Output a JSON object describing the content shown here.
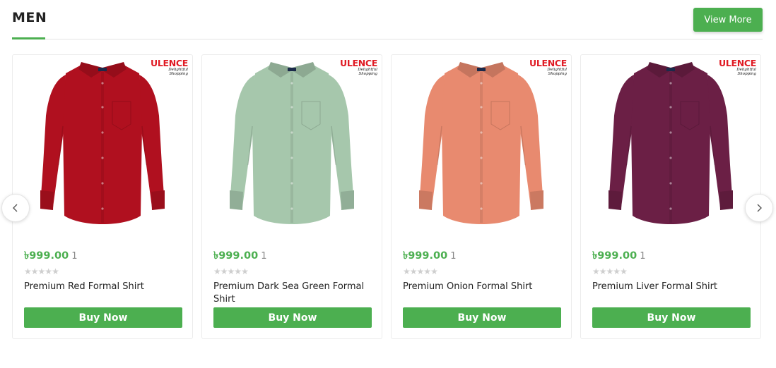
{
  "section": {
    "title": "MEN",
    "view_more_label": "View More",
    "accent_color": "#4caf50"
  },
  "carousel": {
    "prev_icon": "chevron-left-icon",
    "next_icon": "chevron-right-icon"
  },
  "brand": {
    "name": "ULENCE",
    "tagline": "Delightful Shopping",
    "color": "#e01b24"
  },
  "products": [
    {
      "name": "Premium Red Formal Shirt",
      "price": "৳999.00",
      "review_count": "1",
      "rating_stars": 5,
      "shirt_color": "#b0101f",
      "buy_label": "Buy Now"
    },
    {
      "name": "Premium Dark Sea Green Formal Shirt",
      "price": "৳999.00",
      "review_count": "1",
      "rating_stars": 5,
      "shirt_color": "#a6c7ac",
      "buy_label": "Buy Now"
    },
    {
      "name": "Premium Onion Formal Shirt",
      "price": "৳999.00",
      "review_count": "1",
      "rating_stars": 5,
      "shirt_color": "#e88a6f",
      "buy_label": "Buy Now"
    },
    {
      "name": "Premium Liver Formal Shirt",
      "price": "৳999.00",
      "review_count": "1",
      "rating_stars": 5,
      "shirt_color": "#6b1f45",
      "buy_label": "Buy Now"
    }
  ]
}
